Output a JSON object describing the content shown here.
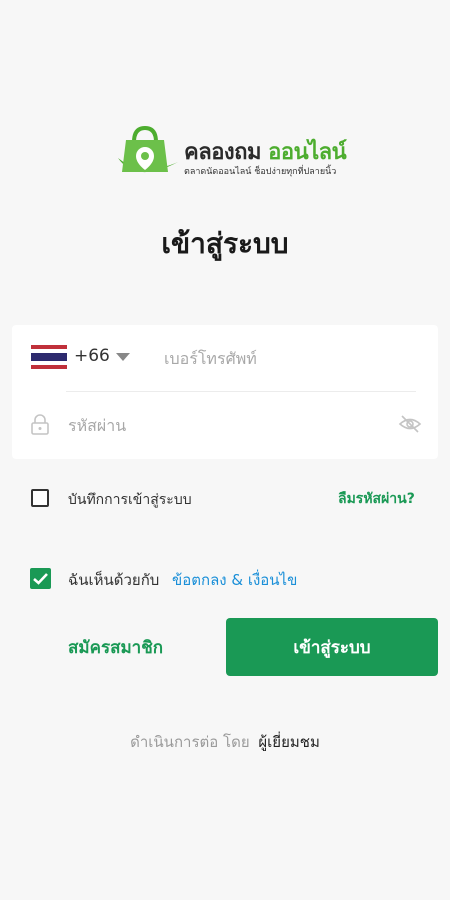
{
  "brand": {
    "name_part1": "คลองถม",
    "name_part2": "ออนไลน์",
    "tagline": "ตลาดนัดออนไลน์ ช็อปง่ายทุกที่ปลายนิ้ว",
    "accent_color": "#4dad2f"
  },
  "page_title": "เข้าสู่ระบบ",
  "login_form": {
    "country_flag": "thailand-flag",
    "country_code": "+66",
    "phone_placeholder": "เบอร์โทรศัพท์",
    "phone_value": "",
    "password_placeholder": "รหัสผ่าน",
    "password_value": "",
    "lock_icon": "lock-icon",
    "visibility_icon": "eye-off-icon"
  },
  "remember_me": {
    "label": "บันทึกการเข้าสู่ระบบ",
    "checked": false
  },
  "forgot_password_label": "ลืมรหัสผ่าน?",
  "terms": {
    "prefix": "ฉันเห็นด้วยกับ",
    "link_label": "ข้อตกลง & เงื่อนไข",
    "checked": true
  },
  "buttons": {
    "register_label": "สมัครสมาชิก",
    "login_label": "เข้าสู่ระบบ"
  },
  "guest": {
    "prefix": "ดำเนินการต่อ โดย",
    "link_label": "ผู้เยี่ยมชม"
  },
  "colors": {
    "primary": "#1a9955",
    "link_blue": "#1a8fd8",
    "background": "#f7f7f7"
  }
}
